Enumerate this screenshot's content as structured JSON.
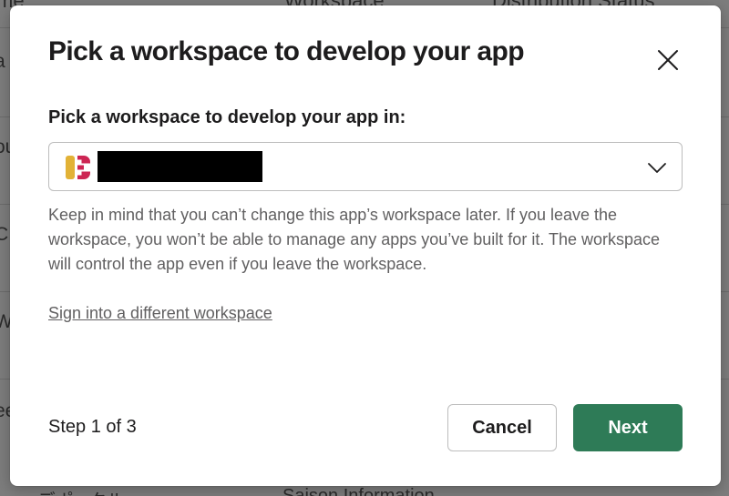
{
  "background": {
    "headers": [
      "me",
      "Workspace",
      "Distribution Status"
    ],
    "row_fragments": [
      "a",
      "ou",
      "C",
      "W",
      "ee"
    ],
    "footer": [
      "...ッデポ...クル...",
      "Saison Information"
    ]
  },
  "modal": {
    "title": "Pick a workspace to develop your app",
    "close_icon": "close-icon",
    "field_label": "Pick a workspace to develop your app in:",
    "select": {
      "logo_icon": "workspace-logo-icon",
      "selected_value": "",
      "chevron_icon": "chevron-down-icon"
    },
    "help_text": "Keep in mind that you can’t change this app’s workspace later. If you leave the workspace, you won’t be able to manage any apps you’ve built for it. The workspace will control the app even if you leave the workspace.",
    "link": "Sign into a different workspace",
    "step": "Step 1 of 3",
    "cancel_label": "Cancel",
    "next_label": "Next"
  },
  "colors": {
    "primary_button": "#2e7b57",
    "logo_yellow": "#e2b236",
    "logo_red": "#cd2553",
    "text_dark": "#1d1c1d",
    "text_muted": "#616061"
  }
}
